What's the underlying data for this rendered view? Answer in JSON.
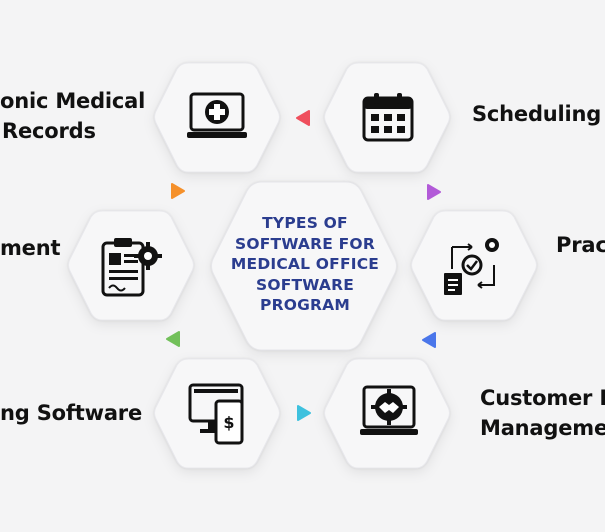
{
  "center": {
    "lines": [
      "TYPES OF",
      "SOFTWARE FOR",
      "MEDICAL OFFICE",
      "SOFTWARE",
      "PROGRAM"
    ]
  },
  "labels": {
    "ehr": [
      "onic Medical",
      "Records"
    ],
    "scheduling": [
      "Scheduling S"
    ],
    "management": [
      "ment"
    ],
    "practice": [
      "Pract"
    ],
    "billing": [
      "ng Software"
    ],
    "crm": [
      "Customer R",
      "Manageme"
    ]
  },
  "colors": {
    "title": "#2b3d8f",
    "arrow_top": "#ef4f5d",
    "arrow_upper_left": "#f5902a",
    "arrow_upper_right": "#b25ad8",
    "arrow_lower_left": "#72c05a",
    "arrow_lower_right": "#4a76ea",
    "arrow_bottom": "#3ec1de"
  },
  "icons": {
    "ehr": "medical-laptop-icon",
    "scheduling": "calendar-icon",
    "management": "clipboard-gear-icon",
    "practice": "document-gear-icon",
    "billing": "computer-billing-icon",
    "crm": "handshake-gear-icon"
  }
}
